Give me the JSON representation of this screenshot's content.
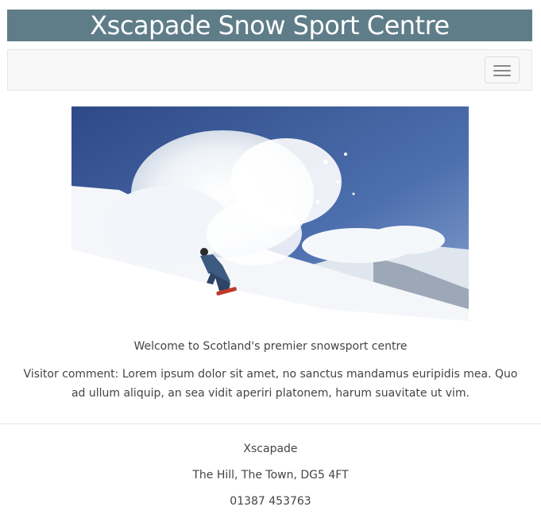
{
  "header": {
    "title": "Xscapade Snow Sport Centre"
  },
  "navbar": {
    "toggle_icon": "hamburger-menu-icon"
  },
  "hero": {
    "image_subject": "snowboarder-spray"
  },
  "main": {
    "welcome_text": "Welcome to Scotland's premier snowsport centre",
    "visitor_comment": "Visitor comment: Lorem ipsum dolor sit amet, no sanctus mandamus euripidis mea. Quo ad ullum aliquip, an sea vidit aperiri platonem, harum suavitate ut vim."
  },
  "footer": {
    "name": "Xscapade",
    "address": "The Hill, The Town, DG5 4FT",
    "phone": "01387 453763"
  },
  "colors": {
    "banner_bg": "#5f7d88",
    "banner_text": "#ffffff",
    "navbar_bg": "#f8f8f8",
    "body_text": "#444444"
  }
}
